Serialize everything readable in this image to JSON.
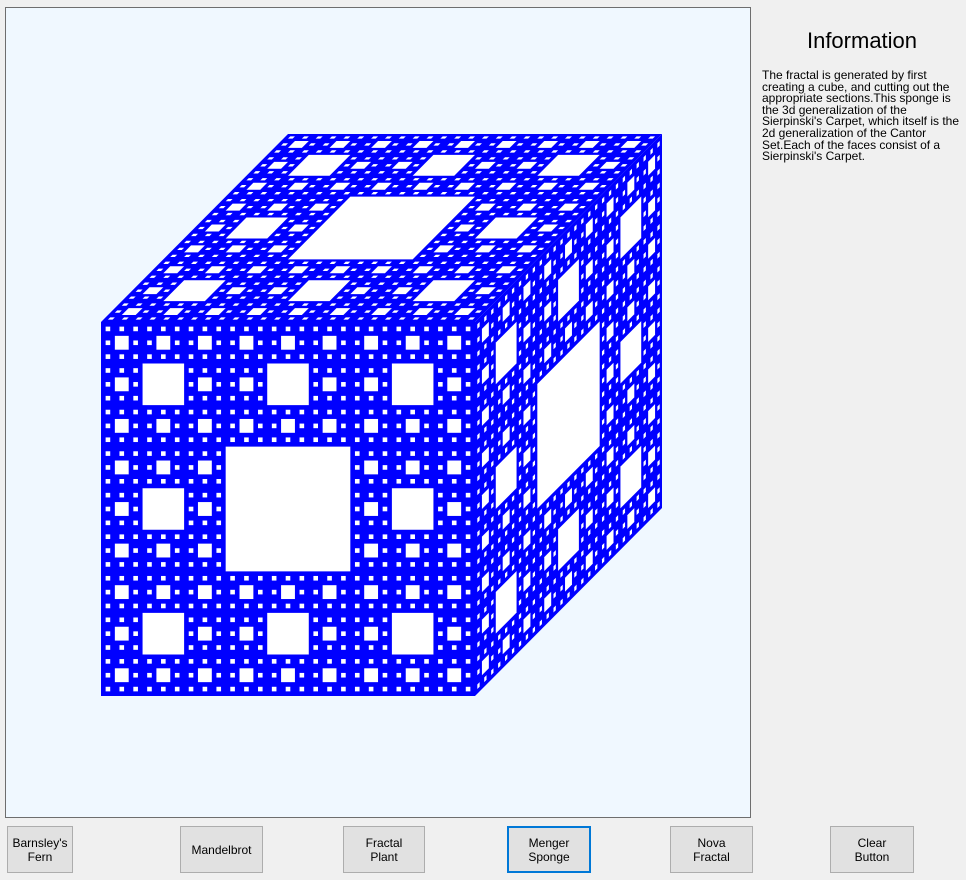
{
  "info": {
    "title": "Information",
    "text": "The fractal is generated by first creating a cube, and cutting out the appropriate sections.This sponge is the 3d generalization of the Sierpinski's Carpet, which itself is the 2d generalization of the Cantor Set.Each of the faces consist of a Sierpinski's Carpet."
  },
  "buttons": [
    {
      "name": "barnsleys-fern-button",
      "label": "Barnsley's\nFern"
    },
    {
      "name": "mandelbrot-button",
      "label": "Mandelbrot"
    },
    {
      "name": "fractal-plant-button",
      "label": "Fractal\nPlant"
    },
    {
      "name": "menger-sponge-button",
      "label": "Menger\nSponge"
    },
    {
      "name": "nova-fractal-button",
      "label": "Nova\nFractal"
    },
    {
      "name": "clear-button",
      "label": "Clear\nButton"
    }
  ],
  "active_button": "menger-sponge-button",
  "colors": {
    "sponge": "#0000ff",
    "hole": "#ffffff",
    "canvas_bg": "#f0f8ff",
    "active_border": "#0078d7"
  },
  "fractal": {
    "type": "menger-sponge",
    "level": 4
  }
}
